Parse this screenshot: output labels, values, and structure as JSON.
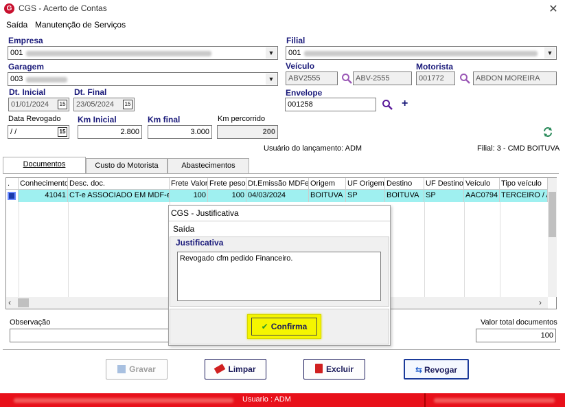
{
  "window": {
    "title": "CGS - Acerto de Contas",
    "close": "✕"
  },
  "menu": [
    "Saída",
    "Manutenção de Serviços"
  ],
  "form": {
    "empresa_label": "Empresa",
    "empresa_value": "001",
    "filial_label": "Filial",
    "filial_value": "001",
    "garagem_label": "Garagem",
    "garagem_value": "003",
    "veiculo_label": "Veículo",
    "veiculo_code": "ABV2555",
    "veiculo_desc": "ABV-2555",
    "motorista_label": "Motorista",
    "motorista_code": "001772",
    "motorista_name": "ABDON MOREIRA",
    "dt_inicial_label": "Dt. Inicial",
    "dt_inicial": "01/01/2024",
    "dt_final_label": "Dt. Final",
    "dt_final": "23/05/2024",
    "envelope_label": "Envelope",
    "envelope_value": "001258",
    "data_revogado_label": "Data Revogado",
    "data_revogado": " / /",
    "km_inicial_label": "Km Inicial",
    "km_inicial": "2.800",
    "km_final_label": "Km final",
    "km_final": "3.000",
    "km_percorrido_label": "Km percorrido",
    "km_percorrido": "200",
    "usuario_lancamento": "Usuário do lançamento: ADM",
    "filial_info": "Filial: 3 - CMD BOITUVA",
    "calendar_glyph": "15",
    "plus_glyph": "+"
  },
  "tabs": [
    "Documentos",
    "Custo do Motorista",
    "Abastecimentos"
  ],
  "grid": {
    "columns": [
      ".",
      "Conhecimento",
      "Desc. doc.",
      "Frete Valor",
      "Frete peso",
      "Dt.Emissão MDFe",
      "Origem",
      "UF Origem",
      "Destino",
      "UF Destino",
      "Veículo",
      "Tipo veículo"
    ],
    "row": [
      "",
      "41041",
      "CT-e ASSOCIADO EM MDF-e",
      "100",
      "100",
      "04/03/2024",
      "BOITUVA",
      "SP",
      "BOITUVA",
      "SP",
      "AAC0794",
      "TERCEIRO / A"
    ]
  },
  "footer": {
    "observacao_label": "Observação",
    "valor_total_label": "Valor total documentos",
    "valor_total": "100"
  },
  "buttons": {
    "gravar": "Gravar",
    "limpar": "Limpar",
    "excluir": "Excluir",
    "revogar": "Revogar"
  },
  "modal": {
    "title": "CGS - Justificativa",
    "menu": "Saída",
    "group_label": "Justificativa",
    "text": "Revogado cfm pedido Financeiro.",
    "confirm": "Confirma"
  },
  "status": {
    "user": "Usuario : ADM"
  },
  "colors": {
    "accent": "#1a1a7a",
    "status_bar": "#e8101a",
    "selected_row": "#9ff0f0",
    "confirm_bg": "#f5f500"
  }
}
